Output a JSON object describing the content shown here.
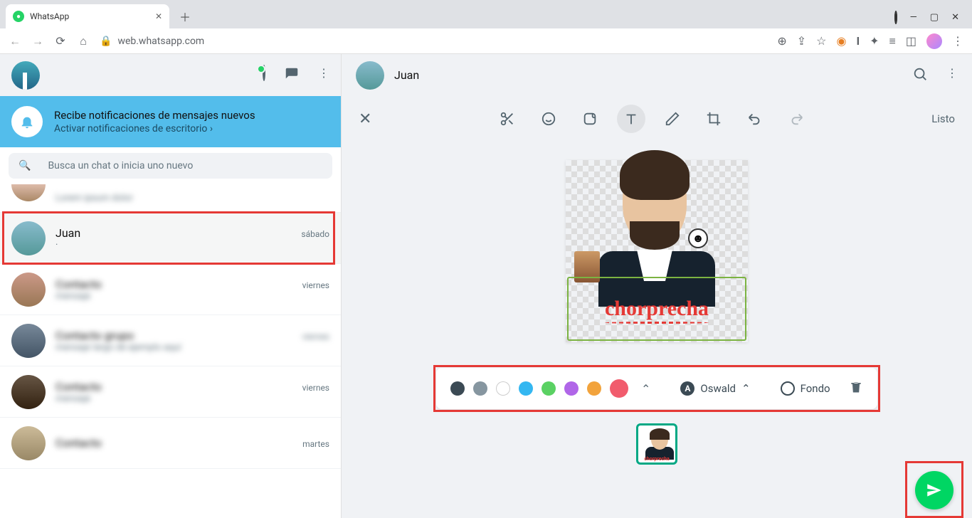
{
  "browser": {
    "tab_title": "WhatsApp",
    "url": "web.whatsapp.com"
  },
  "sidebar": {
    "notification": {
      "title": "Recibe notificaciones de mensajes nuevos",
      "action": "Activar notificaciones de escritorio ›"
    },
    "search_placeholder": "Busca un chat o inicia uno nuevo",
    "chats": [
      {
        "name": "Juan",
        "time": "sábado",
        "msg": ""
      },
      {
        "name": "Contacto",
        "time": "viernes",
        "msg": "mensaje"
      },
      {
        "name": "Contacto grupo",
        "time": "viernes",
        "msg": "mensaje largo de ejemplo aquí"
      },
      {
        "name": "Contacto",
        "time": "viernes",
        "msg": "mensaje"
      },
      {
        "name": "Contacto",
        "time": "martes",
        "msg": ""
      }
    ]
  },
  "main": {
    "contact_name": "Juan",
    "done_label": "Listo",
    "sticker_text": "chorprecha",
    "font_name": "Oswald",
    "bg_label": "Fondo",
    "colors": {
      "dark": "#3b4a54",
      "gray": "#8696a0",
      "white": "#ffffff",
      "blue": "#34b7f1",
      "green": "#5ad163",
      "purple": "#b066e8",
      "orange": "#f2a33c",
      "red": "#f15c6d"
    }
  }
}
